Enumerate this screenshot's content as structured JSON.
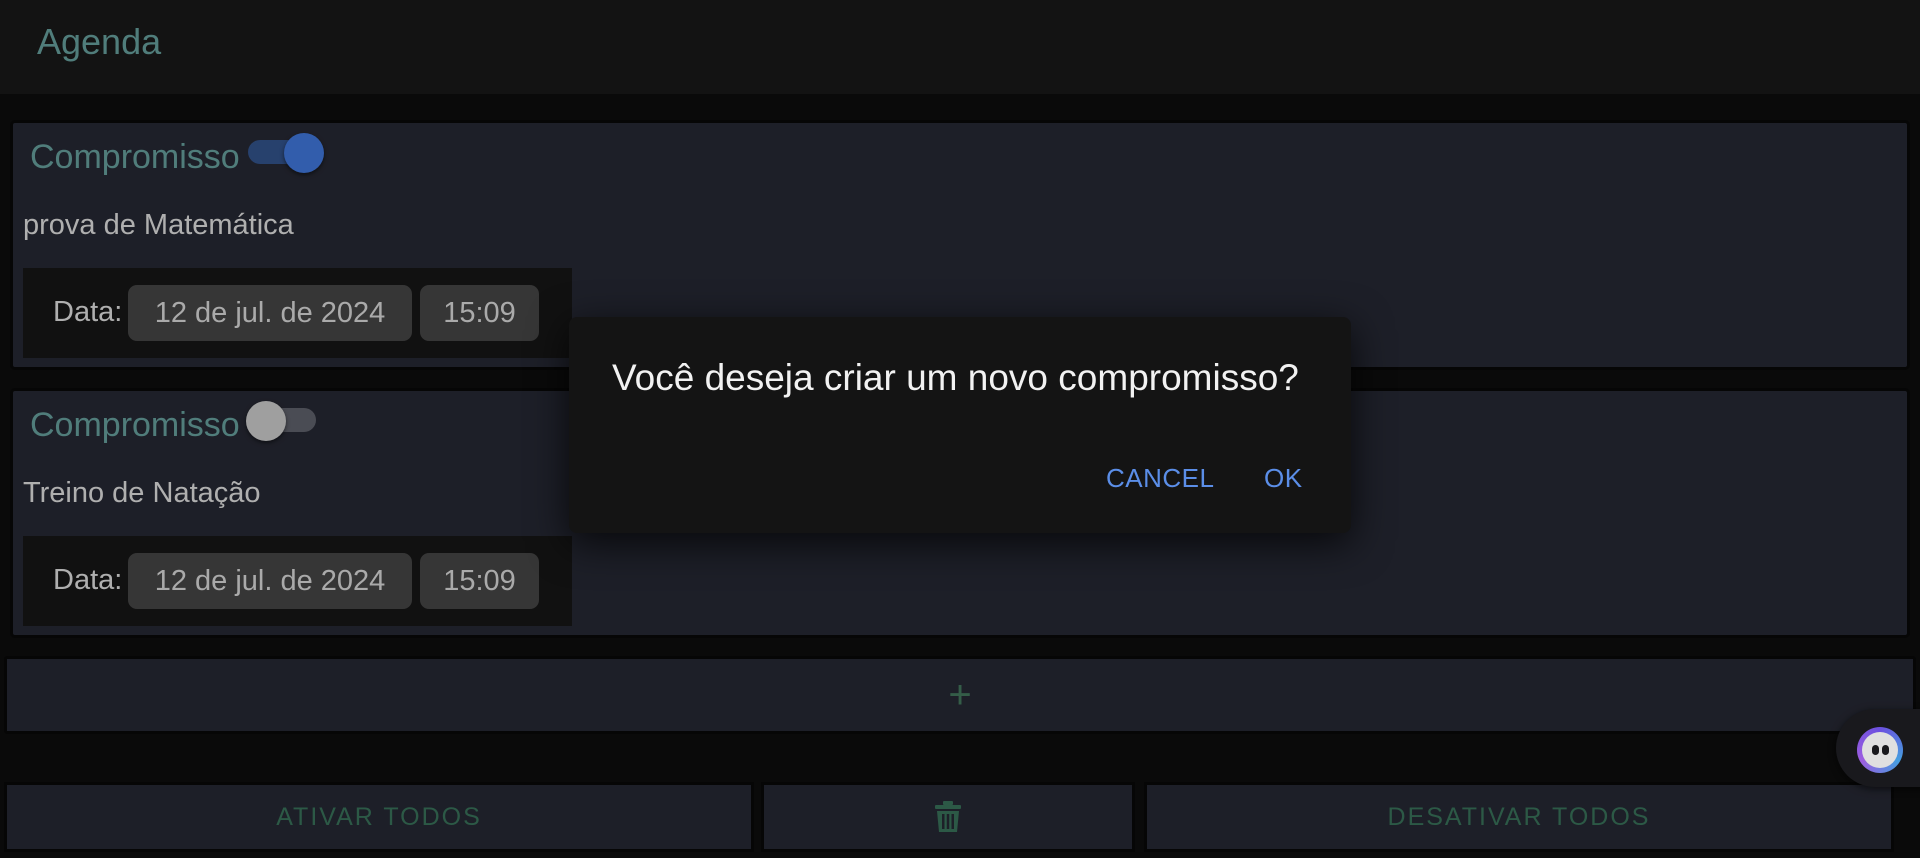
{
  "header": {
    "title": "Agenda"
  },
  "appointments": [
    {
      "label": "Compromisso",
      "active": true,
      "description": "prova de Matemática",
      "date_label": "Data:",
      "date": "12 de jul. de 2024",
      "time": "15:09"
    },
    {
      "label": "Compromisso",
      "active": false,
      "description": "Treino de Natação",
      "date_label": "Data:",
      "date": "12 de jul. de 2024",
      "time": "15:09"
    }
  ],
  "add_button": {
    "label": "+"
  },
  "footer": {
    "activate_all": "ATIVAR TODOS",
    "delete_icon": "trash-icon",
    "deactivate_all": "DESATIVAR TODOS"
  },
  "dialog": {
    "message": "Você deseja criar um novo compromisso?",
    "cancel": "CANCEL",
    "ok": "OK"
  },
  "widget": {
    "icon": "assistant-bot-icon"
  },
  "colors": {
    "accent_teal": "#5c8f8c",
    "toggle_on": "#3a6ac4",
    "dialog_button": "#5b8ee8",
    "footer_text": "#336650"
  }
}
